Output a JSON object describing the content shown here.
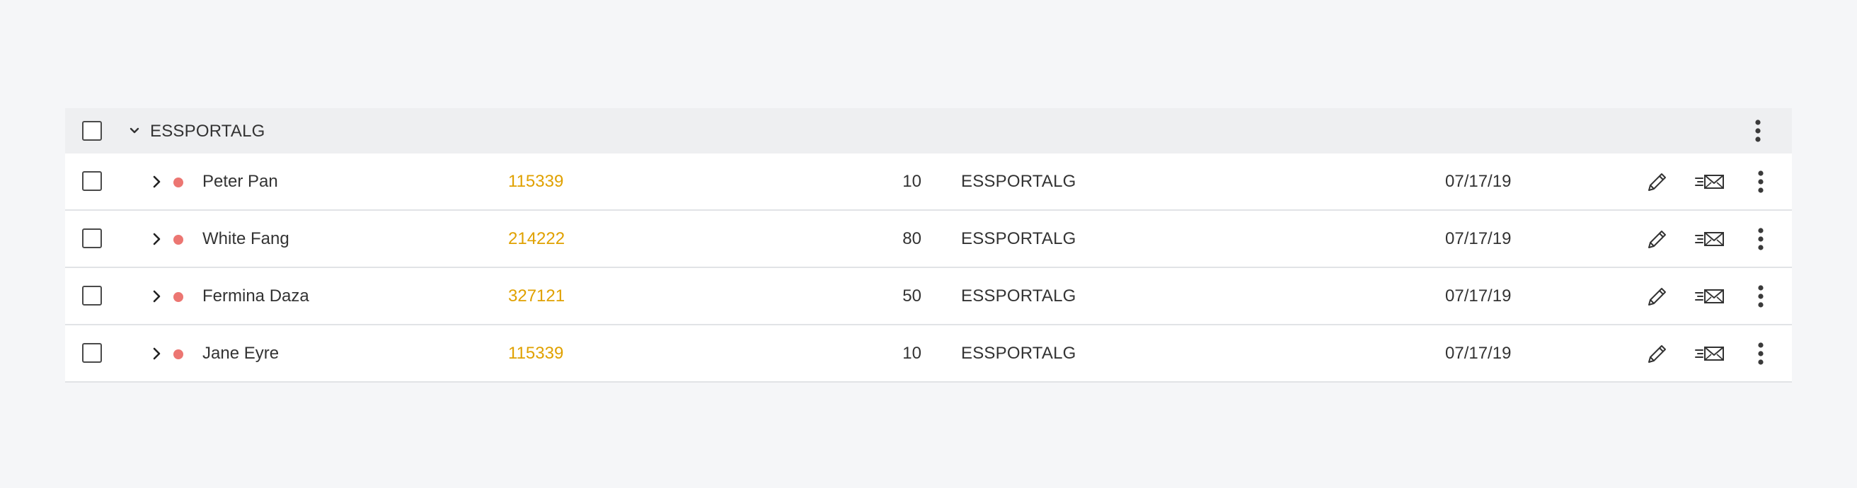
{
  "group": {
    "label": "ESSPORTALG"
  },
  "rows": [
    {
      "name": "Peter Pan",
      "id": "115339",
      "qty": "10",
      "org": "ESSPORTALG",
      "date": "07/17/19"
    },
    {
      "name": "White Fang",
      "id": "214222",
      "qty": "80",
      "org": "ESSPORTALG",
      "date": "07/17/19"
    },
    {
      "name": "Fermina Daza",
      "id": "327121",
      "qty": "50",
      "org": "ESSPORTALG",
      "date": "07/17/19"
    },
    {
      "name": "Jane Eyre",
      "id": "115339",
      "qty": "10",
      "org": "ESSPORTALG",
      "date": "07/17/19"
    }
  ],
  "colors": {
    "status_dot": "#ec7672",
    "id_link": "#e0a100",
    "group_bg": "#eeeff1",
    "page_bg": "#f5f6f8"
  },
  "icons": {
    "group_toggle": "chevron-down-icon",
    "row_toggle": "chevron-right-icon",
    "menu": "more-vertical-icon",
    "edit": "pencil-icon",
    "send": "send-mail-icon",
    "status": "status-dot"
  }
}
